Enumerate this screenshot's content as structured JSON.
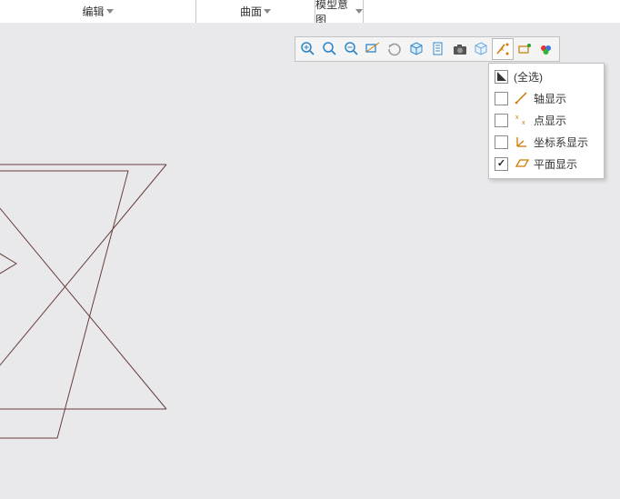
{
  "menu": {
    "edit": "编辑",
    "surface": "曲面",
    "modelIntent": "模型意图"
  },
  "toolbar": {
    "items": [
      {
        "name": "zoom-fit",
        "type": "zoom-plus"
      },
      {
        "name": "zoom-in",
        "type": "zoom"
      },
      {
        "name": "zoom-out",
        "type": "zoom-minus"
      },
      {
        "name": "zoom-window",
        "type": "zoom-rect"
      },
      {
        "name": "refit",
        "type": "spin"
      },
      {
        "name": "view-orientation",
        "type": "cube"
      },
      {
        "name": "saved-views",
        "type": "page"
      },
      {
        "name": "snapshot",
        "type": "camera"
      },
      {
        "name": "layers",
        "type": "isocube"
      },
      {
        "name": "datum-display",
        "type": "datum",
        "active": true
      },
      {
        "name": "annotation-display",
        "type": "annot"
      },
      {
        "name": "spin-center",
        "type": "rgb"
      }
    ]
  },
  "panel": {
    "title": "(全选)",
    "rows": [
      {
        "id": "axis",
        "label": "轴显示",
        "checked": false,
        "icon": "axis"
      },
      {
        "id": "point",
        "label": "点显示",
        "checked": false,
        "icon": "point"
      },
      {
        "id": "csys",
        "label": "坐标系显示",
        "checked": false,
        "icon": "csys"
      },
      {
        "id": "plane",
        "label": "平面显示",
        "checked": true,
        "icon": "plane"
      }
    ]
  }
}
